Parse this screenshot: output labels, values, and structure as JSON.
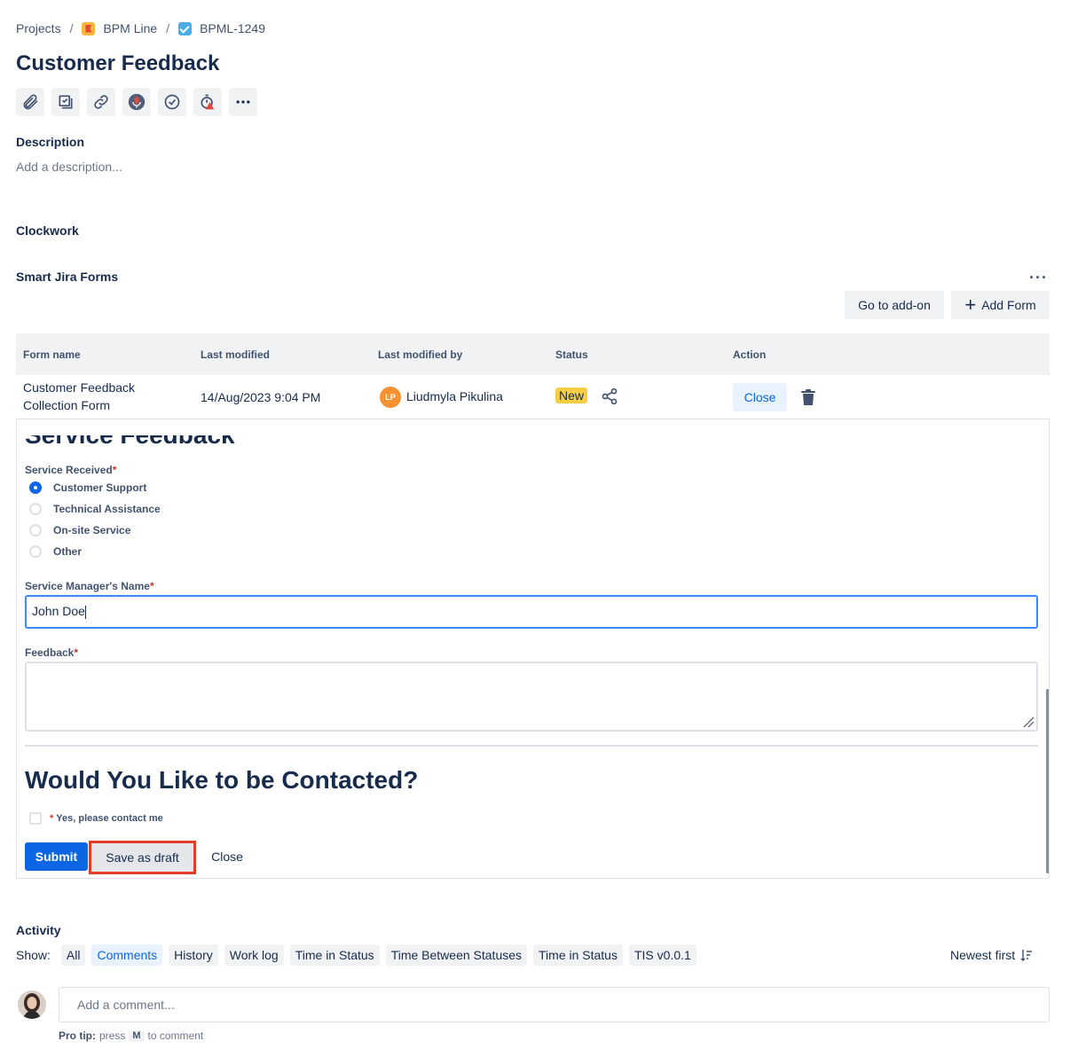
{
  "breadcrumb": {
    "projects": "Projects",
    "separator": "/",
    "project_name": "BPM Line",
    "issue_key": "BPML-1249"
  },
  "issue": {
    "title": "Customer Feedback"
  },
  "toolbar": {
    "icons": [
      "paperclip-icon",
      "checklist-icon",
      "link-icon",
      "microphone-icon",
      "clock-icon",
      "timer-alert-icon",
      "more-icon"
    ]
  },
  "description": {
    "label": "Description",
    "placeholder": "Add a description..."
  },
  "clockwork": {
    "label": "Clockwork"
  },
  "smart_forms": {
    "label": "Smart Jira Forms",
    "more": "···",
    "go_to_addon": "Go to add-on",
    "add_form": "Add Form",
    "columns": [
      "Form name",
      "Last modified",
      "Last modified by",
      "Status",
      "Action"
    ],
    "row": {
      "form_name_line1": "Customer Feedback",
      "form_name_line2": "Collection Form",
      "last_modified": "14/Aug/2023 9:04 PM",
      "avatar_initials": "LP",
      "modified_by": "Liudmyla Pikulina",
      "status": "New",
      "action_close": "Close"
    }
  },
  "form": {
    "section_title": "Service Feedback",
    "service_label": "Service Received",
    "required_mark": "*",
    "service_options": [
      "Customer Support",
      "Technical Assistance",
      "On-site Service",
      "Other"
    ],
    "selected_option": "Customer Support",
    "manager_label": "Service Manager's Name",
    "manager_value": "John Doe",
    "feedback_label": "Feedback",
    "contact_title": "Would You Like to be Contacted?",
    "contact_checkbox": "Yes, please contact me",
    "submit": "Submit",
    "save_draft": "Save as draft",
    "close": "Close"
  },
  "activity": {
    "label": "Activity",
    "show_label": "Show:",
    "filters": [
      "All",
      "Comments",
      "History",
      "Work log",
      "Time in Status",
      "Time Between Statuses",
      "Time in Status",
      "TIS v0.0.1"
    ],
    "active_filter": "Comments",
    "sort": "Newest first",
    "comment_placeholder": "Add a comment...",
    "pro_tip_bold": "Pro tip:",
    "pro_tip_press": "press",
    "pro_tip_key": "M",
    "pro_tip_end": "to comment"
  },
  "colors": {
    "accent": "#0c66e4",
    "status_new": "#f5cd47",
    "highlight": "#e23c2a"
  }
}
